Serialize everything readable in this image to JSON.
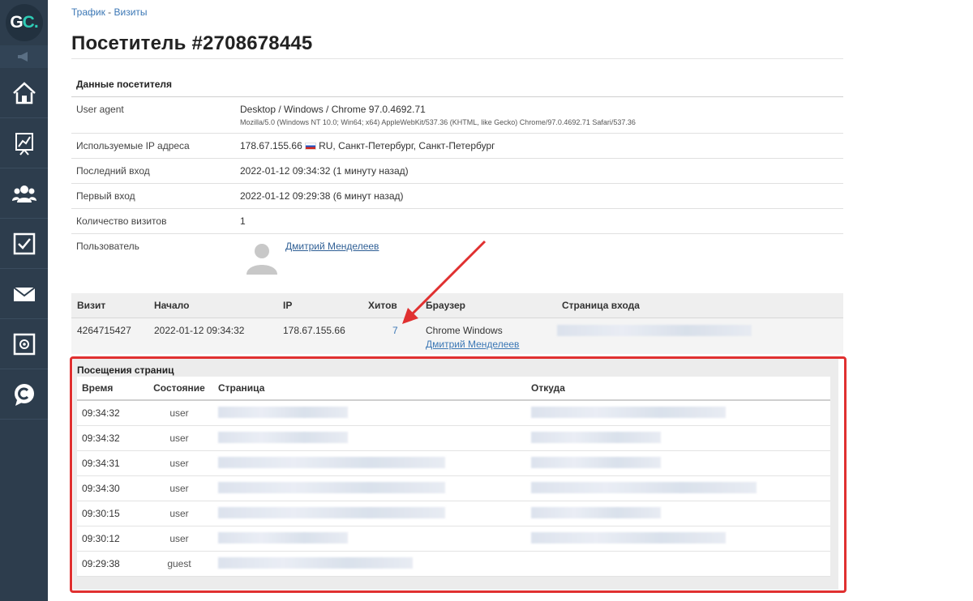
{
  "sidebar": {
    "logo": {
      "g": "G",
      "c": "C",
      "dot": "."
    },
    "items": [
      "home-icon",
      "chart-icon",
      "users-icon",
      "tasks-icon",
      "mail-icon",
      "settings-safe-icon",
      "chat-icon"
    ]
  },
  "breadcrumb": {
    "traffic": "Трафик",
    "separator": " - ",
    "visits": "Визиты"
  },
  "page": {
    "title": "Посетитель #2708678445"
  },
  "visitor": {
    "section_title": "Данные посетителя",
    "user_agent_label": "User agent",
    "user_agent_summary": "Desktop / Windows / Chrome 97.0.4692.71",
    "user_agent_full": "Mozilla/5.0 (Windows NT 10.0; Win64; x64) AppleWebKit/537.36 (KHTML, like Gecko) Chrome/97.0.4692.71 Safari/537.36",
    "ip_label": "Используемые IP адреса",
    "ip_address": "178.67.155.66",
    "ip_location": "RU, Санкт-Петербург, Санкт-Петербург",
    "last_login_label": "Последний вход",
    "last_login_value": "2022-01-12 09:34:32 (1 минуту назад)",
    "first_login_label": "Первый вход",
    "first_login_value": "2022-01-12 09:29:38 (6 минут назад)",
    "visits_count_label": "Количество визитов",
    "visits_count_value": "1",
    "user_label": "Пользователь",
    "user_name": "Дмитрий Менделеев"
  },
  "visits_table": {
    "headers": [
      "Визит",
      "Начало",
      "IP",
      "Хитов",
      "Браузер",
      "Страница входа"
    ],
    "row": {
      "visit_id": "4264715427",
      "start": "2022-01-12 09:34:32",
      "ip": "178.67.155.66",
      "hits": "7",
      "browser": "Chrome Windows",
      "browser_user": "Дмитрий Менделеев"
    }
  },
  "page_visits": {
    "title": "Посещения страниц",
    "headers": [
      "Время",
      "Состояние",
      "Страница",
      "Откуда"
    ],
    "rows": [
      {
        "time": "09:34:32",
        "state": "user"
      },
      {
        "time": "09:34:32",
        "state": "user"
      },
      {
        "time": "09:34:31",
        "state": "user"
      },
      {
        "time": "09:34:30",
        "state": "user"
      },
      {
        "time": "09:30:15",
        "state": "user"
      },
      {
        "time": "09:30:12",
        "state": "user"
      },
      {
        "time": "09:29:38",
        "state": "guest"
      }
    ]
  },
  "colors": {
    "sidebar": "#2d3d4d",
    "link": "#3b77b5",
    "highlight": "#e03030",
    "accent": "#2ecbb5"
  }
}
